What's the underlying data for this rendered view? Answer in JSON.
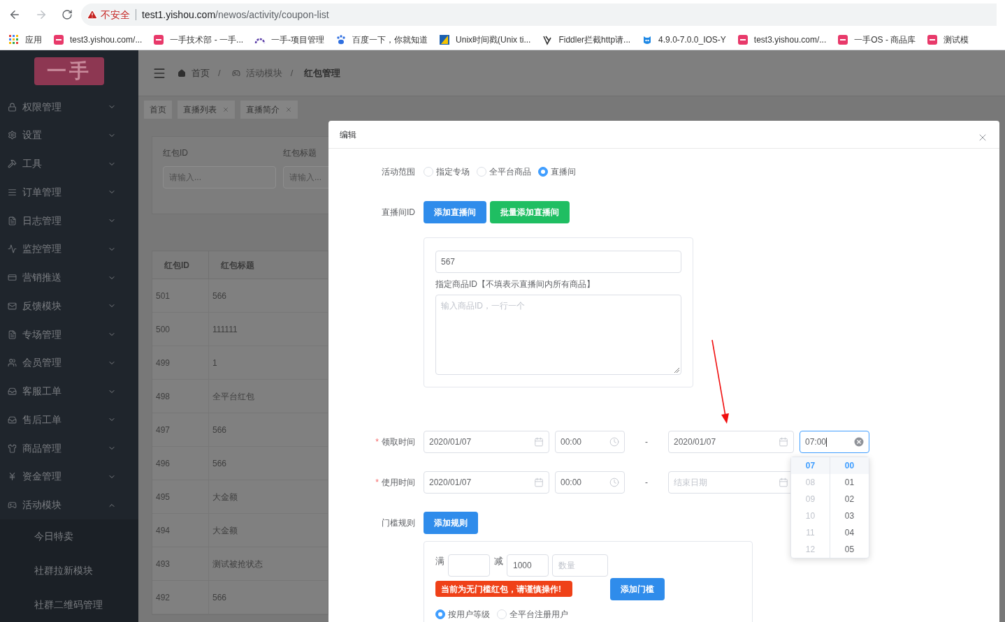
{
  "browser": {
    "warning": "不安全",
    "host": "test1.yishou.com",
    "path": "/newos/activity/coupon-list",
    "bookmarks": [
      {
        "label": "应用"
      },
      {
        "label": "test3.yishou.com/..."
      },
      {
        "label": "一手技术部 - 一手..."
      },
      {
        "label": "一手-项目管理"
      },
      {
        "label": "百度一下，你就知道"
      },
      {
        "label": "Unix时间戳(Unix ti..."
      },
      {
        "label": "Fiddler拦截http请..."
      },
      {
        "label": "4.9.0-7.0.0_IOS-Y"
      },
      {
        "label": "test3.yishou.com/..."
      },
      {
        "label": "一手OS - 商品库"
      },
      {
        "label": "测试模"
      }
    ]
  },
  "sidebar": {
    "logo": "一手",
    "items": [
      {
        "label": "权限管理",
        "expanded": false
      },
      {
        "label": "设置",
        "expanded": false
      },
      {
        "label": "工具",
        "expanded": false
      },
      {
        "label": "订单管理",
        "expanded": false
      },
      {
        "label": "日志管理",
        "expanded": false
      },
      {
        "label": "监控管理",
        "expanded": false
      },
      {
        "label": "营销推送",
        "expanded": false
      },
      {
        "label": "反馈模块",
        "expanded": false
      },
      {
        "label": "专场管理",
        "expanded": false
      },
      {
        "label": "会员管理",
        "expanded": false
      },
      {
        "label": "客服工单",
        "expanded": false
      },
      {
        "label": "售后工单",
        "expanded": false
      },
      {
        "label": "商品管理",
        "expanded": false
      },
      {
        "label": "资金管理",
        "expanded": false
      },
      {
        "label": "活动模块",
        "expanded": true,
        "children": [
          {
            "label": "今日特卖"
          },
          {
            "label": "社群拉新模块"
          },
          {
            "label": "社群二维码管理"
          }
        ]
      }
    ]
  },
  "breadcrumb": {
    "separator": "/",
    "items": [
      {
        "label": "首页"
      },
      {
        "label": "活动模块"
      },
      {
        "label": "红包管理"
      }
    ]
  },
  "tags": [
    {
      "label": "首页",
      "closable": false
    },
    {
      "label": "直播列表",
      "closable": true
    },
    {
      "label": "直播简介",
      "closable": true
    }
  ],
  "filters": [
    {
      "label": "红包ID",
      "placeholder": "请输入..."
    },
    {
      "label": "红包标题",
      "placeholder": "请输入..."
    }
  ],
  "table": {
    "columns": [
      "红包ID",
      "红包标题"
    ],
    "rows": [
      [
        "501",
        "566"
      ],
      [
        "500",
        "111111"
      ],
      [
        "499",
        "1"
      ],
      [
        "498",
        "全平台红包"
      ],
      [
        "497",
        "566"
      ],
      [
        "496",
        "566"
      ],
      [
        "495",
        "大金额"
      ],
      [
        "494",
        "大金额"
      ],
      [
        "493",
        "测试被抢状态"
      ],
      [
        "492",
        "566"
      ]
    ]
  },
  "dialog": {
    "title": "编辑",
    "scope": {
      "label": "活动范围",
      "options": [
        {
          "label": "指定专场",
          "selected": false
        },
        {
          "label": "全平台商品",
          "selected": false
        },
        {
          "label": "直播间",
          "selected": true
        }
      ]
    },
    "live": {
      "label": "直播间ID",
      "buttons": [
        {
          "label": "添加直播间",
          "kind": "primary"
        },
        {
          "label": "批量添加直播间",
          "kind": "success"
        }
      ],
      "room_value": "567",
      "goods_label": "指定商品ID【不填表示直播间内所有商品】",
      "goods_placeholder": "输入商品ID，一行一个"
    },
    "times": [
      {
        "label": "领取时间",
        "required_mark": "*",
        "start_date": {
          "value": "2020/01/07"
        },
        "start_time": {
          "value": "00:00"
        },
        "separator": "-",
        "end_date": {
          "value": "2020/01/07"
        },
        "end_time": {
          "value": "07:00",
          "focused": true
        }
      },
      {
        "label": "使用时间",
        "required_mark": "*",
        "start_date": {
          "value": "2020/01/07"
        },
        "start_time": {
          "value": "00:00"
        },
        "separator": "-",
        "end_date": {
          "placeholder": "结束日期"
        }
      }
    ],
    "time_picker": {
      "hours": [
        {
          "label": "07",
          "selected": true,
          "disabled": false
        },
        {
          "label": "08",
          "selected": false,
          "disabled": true
        },
        {
          "label": "09",
          "selected": false,
          "disabled": true
        },
        {
          "label": "10",
          "selected": false,
          "disabled": true
        },
        {
          "label": "11",
          "selected": false,
          "disabled": true
        },
        {
          "label": "12",
          "selected": false,
          "disabled": true
        }
      ],
      "minutes": [
        {
          "label": "00",
          "selected": true,
          "disabled": false
        },
        {
          "label": "01",
          "selected": false,
          "disabled": false
        },
        {
          "label": "02",
          "selected": false,
          "disabled": false
        },
        {
          "label": "03",
          "selected": false,
          "disabled": false
        },
        {
          "label": "04",
          "selected": false,
          "disabled": false
        },
        {
          "label": "05",
          "selected": false,
          "disabled": false
        }
      ]
    },
    "threshold": {
      "label": "门槛规则",
      "add_button": "添加规则",
      "full_label": "满",
      "minus_label": "减",
      "minus_value": "1000",
      "count_placeholder": "数量",
      "warning": "当前为无门槛红包，请谨慎操作!",
      "add_threshold_button": "添加门槛",
      "user_scope": [
        {
          "label": "按用户等级",
          "selected": true
        },
        {
          "label": "全平台注册用户",
          "selected": false
        }
      ]
    }
  }
}
